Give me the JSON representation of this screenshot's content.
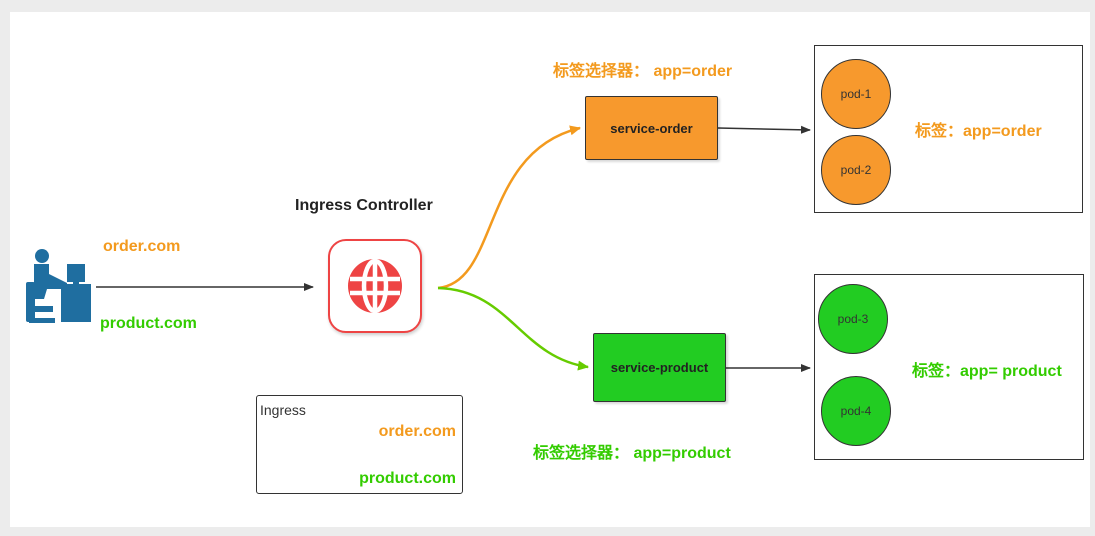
{
  "colors": {
    "orange": "#f39a1e",
    "green": "#33cc00",
    "orange_fill": "#f7992d",
    "green_fill": "#22cc22",
    "ingress_red": "#ee4444",
    "user_blue": "#1f6ea0"
  },
  "icons": {
    "user": "user-at-computer-icon",
    "ingress": "globe-icon"
  },
  "client": {
    "domain_order": "order.com",
    "domain_product": "product.com"
  },
  "ingress_controller": {
    "title": "Ingress Controller"
  },
  "ingress_resource": {
    "title": "Ingress",
    "rule_order": "order.com",
    "rule_product": "product.com"
  },
  "services": {
    "order": {
      "name": "service-order",
      "selector_label": "标签选择器： app=order"
    },
    "product": {
      "name": "service-product",
      "selector_label": "标签选择器： app=product"
    }
  },
  "pod_groups": {
    "order": {
      "pods": [
        "pod-1",
        "pod-2"
      ],
      "label": "标签：app=order"
    },
    "product": {
      "pods": [
        "pod-3",
        "pod-4"
      ],
      "label": "标签：app= product"
    }
  }
}
